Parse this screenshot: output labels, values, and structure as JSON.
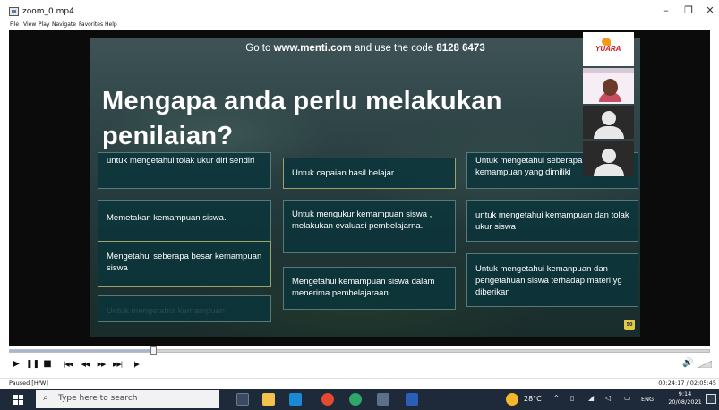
{
  "window": {
    "title": "zoom_0.mp4",
    "controls": {
      "minimize": "–",
      "maximize": "❐",
      "close": "✕"
    }
  },
  "menu": [
    "File",
    "View",
    "Play",
    "Navigate",
    "Favorites",
    "Help"
  ],
  "slide": {
    "menti_prefix": "Go to ",
    "menti_url": "www.menti.com",
    "menti_mid": " and use the code ",
    "menti_code": "8128 6473",
    "title": "Mengapa anda perlu melakukan penilaian?",
    "responses": [
      "untuk mengetahui tolak ukur diri sendiri",
      "Untuk capaian hasil belajar",
      "Untuk mengetahui seberapa besar kemampuan yang dimiliki",
      "Memetakan kemampuan siswa.",
      "Untuk mengukur kemampuan siswa , melakukan evaluasi pembelajarna.",
      "untuk mengetahui kemampuan dan tolak ukur siswa",
      "Mengetahui seberapa besar kemampuan siswa",
      "Mengetahui kemampuan siswa dalam menerima pembelajaraan.",
      "Untuk mengetahui kemanpuan dan pengetahuan siswa terhadap materi yg diberikan",
      "Untuk mengetahui kemampuan"
    ],
    "badge": "50",
    "participant_logo": "YUARA"
  },
  "player": {
    "progress": 0.205,
    "buttons": {
      "play": "▶",
      "pause": "❚❚",
      "stop": "■",
      "prev": "|◀◀",
      "rewind": "◀◀",
      "forward": "▶▶",
      "next": "▶▶|",
      "frame_step": "|▶"
    },
    "status": "Paused [H/W]",
    "time": "00:24:17 / 02:05:45",
    "volume_icon": "🔊"
  },
  "taskbar": {
    "search_placeholder": "Type here to search",
    "temperature": "28°C",
    "language": "ENG",
    "clock_time": "9:14",
    "clock_date": "20/08/2021",
    "colors": {
      "taskbar_bg": "#1e2a3a",
      "accent_menti": "#e2c948"
    }
  }
}
